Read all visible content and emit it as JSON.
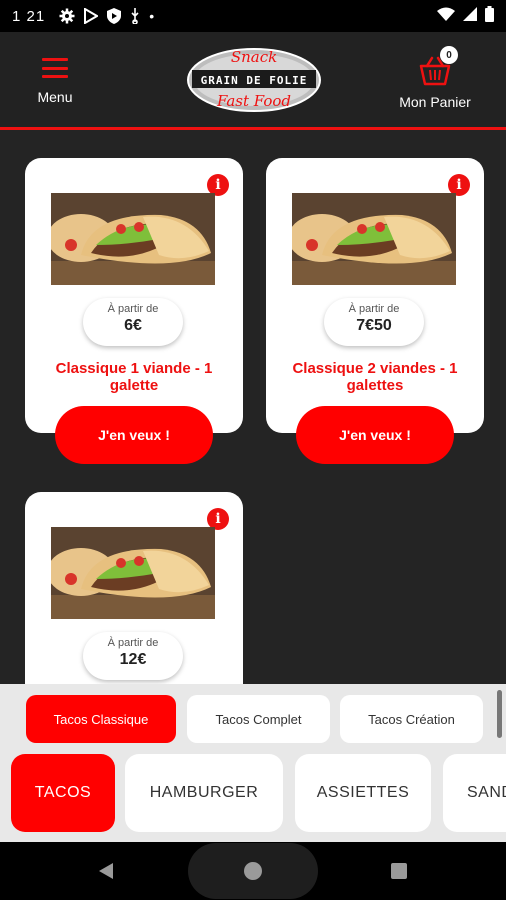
{
  "status_bar": {
    "time": "1 21",
    "dot": "•"
  },
  "header": {
    "menu_label": "Menu",
    "cart_label": "Mon Panier",
    "cart_count": "0",
    "logo": {
      "top": "Snack",
      "middle": "GRAIN DE FOLIE",
      "bottom": "Fast Food"
    }
  },
  "products": [
    {
      "from_label": "À partir de",
      "price": "6€",
      "name": "Classique 1 viande - 1 galette",
      "cta": "J'en veux !"
    },
    {
      "from_label": "À partir de",
      "price": "7€50",
      "name": "Classique 2 viandes - 1 galettes",
      "cta": "J'en veux !"
    },
    {
      "from_label": "À partir de",
      "price": "12€",
      "name": "",
      "cta": ""
    }
  ],
  "subcategories": [
    {
      "label": "Tacos Classique",
      "active": true
    },
    {
      "label": "Tacos Complet",
      "active": false
    },
    {
      "label": "Tacos Création",
      "active": false
    }
  ],
  "categories": [
    {
      "label": "TACOS",
      "active": true
    },
    {
      "label": "HAMBURGER",
      "active": false
    },
    {
      "label": "ASSIETTES",
      "active": false
    },
    {
      "label": "SAND",
      "active": false
    }
  ],
  "colors": {
    "accent": "#ff0000",
    "background": "#242424",
    "bar": "#e8e8e8"
  }
}
